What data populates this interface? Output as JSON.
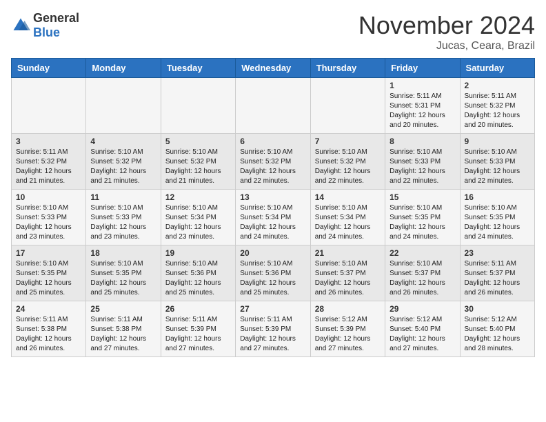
{
  "header": {
    "logo_general": "General",
    "logo_blue": "Blue",
    "month_title": "November 2024",
    "location": "Jucas, Ceara, Brazil"
  },
  "days_of_week": [
    "Sunday",
    "Monday",
    "Tuesday",
    "Wednesday",
    "Thursday",
    "Friday",
    "Saturday"
  ],
  "weeks": [
    [
      {
        "day": "",
        "info": ""
      },
      {
        "day": "",
        "info": ""
      },
      {
        "day": "",
        "info": ""
      },
      {
        "day": "",
        "info": ""
      },
      {
        "day": "",
        "info": ""
      },
      {
        "day": "1",
        "info": "Sunrise: 5:11 AM\nSunset: 5:31 PM\nDaylight: 12 hours\nand 20 minutes."
      },
      {
        "day": "2",
        "info": "Sunrise: 5:11 AM\nSunset: 5:32 PM\nDaylight: 12 hours\nand 20 minutes."
      }
    ],
    [
      {
        "day": "3",
        "info": "Sunrise: 5:11 AM\nSunset: 5:32 PM\nDaylight: 12 hours\nand 21 minutes."
      },
      {
        "day": "4",
        "info": "Sunrise: 5:10 AM\nSunset: 5:32 PM\nDaylight: 12 hours\nand 21 minutes."
      },
      {
        "day": "5",
        "info": "Sunrise: 5:10 AM\nSunset: 5:32 PM\nDaylight: 12 hours\nand 21 minutes."
      },
      {
        "day": "6",
        "info": "Sunrise: 5:10 AM\nSunset: 5:32 PM\nDaylight: 12 hours\nand 22 minutes."
      },
      {
        "day": "7",
        "info": "Sunrise: 5:10 AM\nSunset: 5:32 PM\nDaylight: 12 hours\nand 22 minutes."
      },
      {
        "day": "8",
        "info": "Sunrise: 5:10 AM\nSunset: 5:33 PM\nDaylight: 12 hours\nand 22 minutes."
      },
      {
        "day": "9",
        "info": "Sunrise: 5:10 AM\nSunset: 5:33 PM\nDaylight: 12 hours\nand 22 minutes."
      }
    ],
    [
      {
        "day": "10",
        "info": "Sunrise: 5:10 AM\nSunset: 5:33 PM\nDaylight: 12 hours\nand 23 minutes."
      },
      {
        "day": "11",
        "info": "Sunrise: 5:10 AM\nSunset: 5:33 PM\nDaylight: 12 hours\nand 23 minutes."
      },
      {
        "day": "12",
        "info": "Sunrise: 5:10 AM\nSunset: 5:34 PM\nDaylight: 12 hours\nand 23 minutes."
      },
      {
        "day": "13",
        "info": "Sunrise: 5:10 AM\nSunset: 5:34 PM\nDaylight: 12 hours\nand 24 minutes."
      },
      {
        "day": "14",
        "info": "Sunrise: 5:10 AM\nSunset: 5:34 PM\nDaylight: 12 hours\nand 24 minutes."
      },
      {
        "day": "15",
        "info": "Sunrise: 5:10 AM\nSunset: 5:35 PM\nDaylight: 12 hours\nand 24 minutes."
      },
      {
        "day": "16",
        "info": "Sunrise: 5:10 AM\nSunset: 5:35 PM\nDaylight: 12 hours\nand 24 minutes."
      }
    ],
    [
      {
        "day": "17",
        "info": "Sunrise: 5:10 AM\nSunset: 5:35 PM\nDaylight: 12 hours\nand 25 minutes."
      },
      {
        "day": "18",
        "info": "Sunrise: 5:10 AM\nSunset: 5:35 PM\nDaylight: 12 hours\nand 25 minutes."
      },
      {
        "day": "19",
        "info": "Sunrise: 5:10 AM\nSunset: 5:36 PM\nDaylight: 12 hours\nand 25 minutes."
      },
      {
        "day": "20",
        "info": "Sunrise: 5:10 AM\nSunset: 5:36 PM\nDaylight: 12 hours\nand 25 minutes."
      },
      {
        "day": "21",
        "info": "Sunrise: 5:10 AM\nSunset: 5:37 PM\nDaylight: 12 hours\nand 26 minutes."
      },
      {
        "day": "22",
        "info": "Sunrise: 5:10 AM\nSunset: 5:37 PM\nDaylight: 12 hours\nand 26 minutes."
      },
      {
        "day": "23",
        "info": "Sunrise: 5:11 AM\nSunset: 5:37 PM\nDaylight: 12 hours\nand 26 minutes."
      }
    ],
    [
      {
        "day": "24",
        "info": "Sunrise: 5:11 AM\nSunset: 5:38 PM\nDaylight: 12 hours\nand 26 minutes."
      },
      {
        "day": "25",
        "info": "Sunrise: 5:11 AM\nSunset: 5:38 PM\nDaylight: 12 hours\nand 27 minutes."
      },
      {
        "day": "26",
        "info": "Sunrise: 5:11 AM\nSunset: 5:39 PM\nDaylight: 12 hours\nand 27 minutes."
      },
      {
        "day": "27",
        "info": "Sunrise: 5:11 AM\nSunset: 5:39 PM\nDaylight: 12 hours\nand 27 minutes."
      },
      {
        "day": "28",
        "info": "Sunrise: 5:12 AM\nSunset: 5:39 PM\nDaylight: 12 hours\nand 27 minutes."
      },
      {
        "day": "29",
        "info": "Sunrise: 5:12 AM\nSunset: 5:40 PM\nDaylight: 12 hours\nand 27 minutes."
      },
      {
        "day": "30",
        "info": "Sunrise: 5:12 AM\nSunset: 5:40 PM\nDaylight: 12 hours\nand 28 minutes."
      }
    ]
  ]
}
